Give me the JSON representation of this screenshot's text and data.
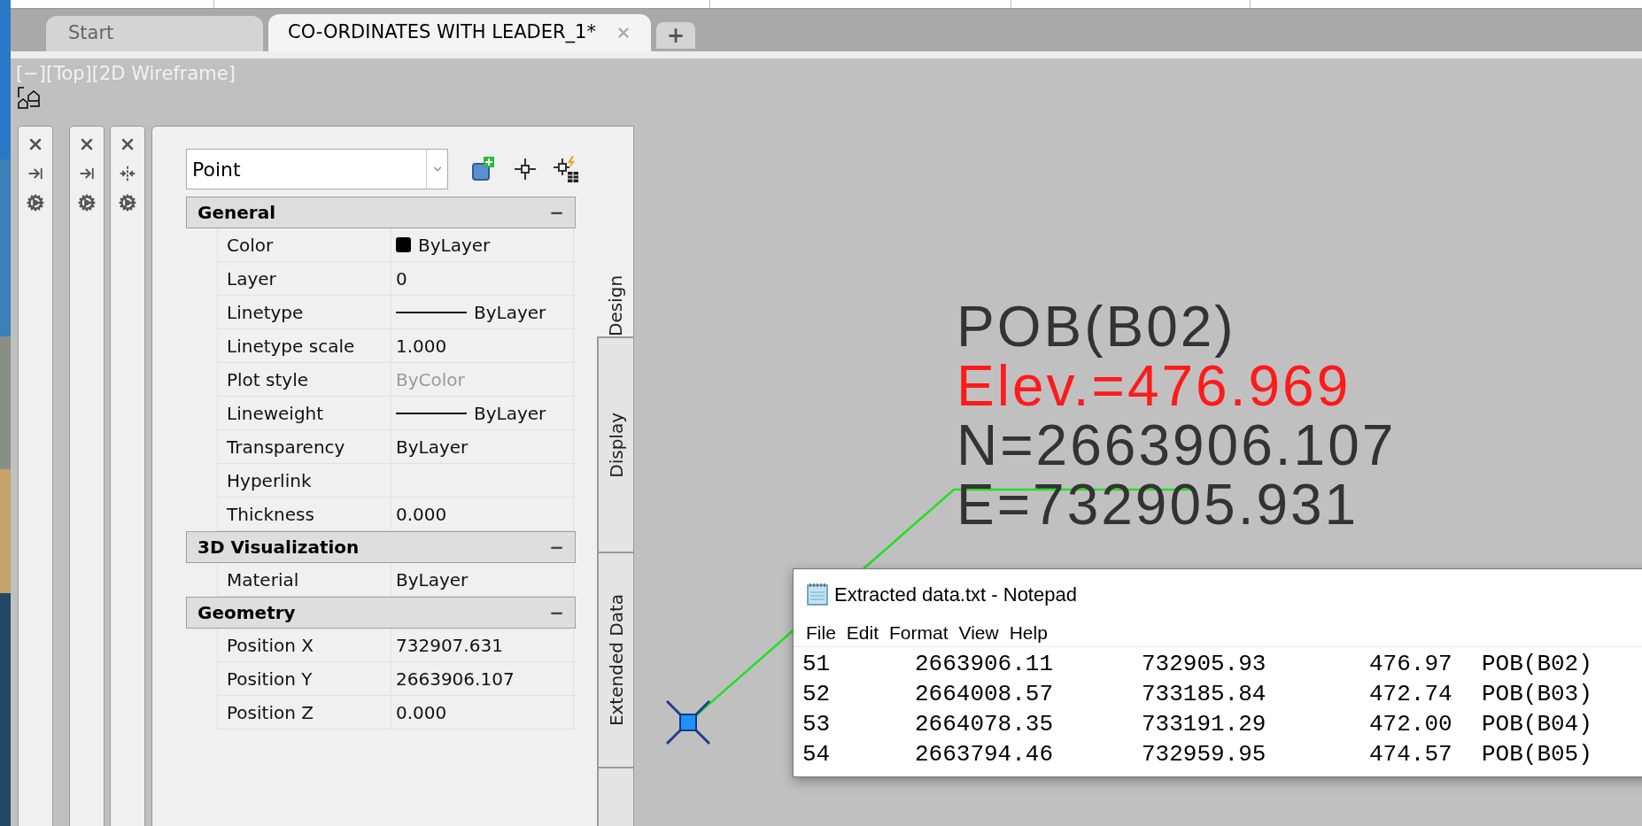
{
  "tabs": [
    {
      "label": "Start",
      "selected": false
    },
    {
      "label": "CO-ORDINATES WITH LEADER_1*",
      "selected": true
    }
  ],
  "new_tab": "+",
  "viewport_label": "[−][Top][2D Wireframe]",
  "properties": {
    "object_type": "Point",
    "sections": [
      {
        "title": "General",
        "toggle": "−",
        "expanded": true,
        "rows": [
          {
            "name": "Color",
            "value": "ByLayer",
            "kind": "swatch"
          },
          {
            "name": "Layer",
            "value": "0",
            "kind": "text"
          },
          {
            "name": "Linetype",
            "value": "ByLayer",
            "kind": "line"
          },
          {
            "name": "Linetype scale",
            "value": "1.000",
            "kind": "text"
          },
          {
            "name": "Plot style",
            "value": "ByColor",
            "kind": "muted"
          },
          {
            "name": "Lineweight",
            "value": "ByLayer",
            "kind": "line"
          },
          {
            "name": "Transparency",
            "value": "ByLayer",
            "kind": "text"
          },
          {
            "name": "Hyperlink",
            "kind": "text"
          },
          {
            "name": "Thickness",
            "value": "0.000",
            "kind": "text"
          }
        ]
      },
      {
        "title": "3D Visualization",
        "toggle": "−",
        "expanded": true,
        "rows": [
          {
            "name": "Material",
            "value": "ByLayer",
            "kind": "text"
          }
        ]
      },
      {
        "title": "Geometry",
        "toggle": "−",
        "expanded": true,
        "rows": [
          {
            "name": "Position X",
            "value": "732907.631",
            "kind": "text"
          },
          {
            "name": "Position Y",
            "value": "2663906.107",
            "kind": "text"
          },
          {
            "name": "Position Z",
            "value": "0.000",
            "kind": "text"
          }
        ]
      }
    ],
    "side_tabs": [
      {
        "label": "Design",
        "selected": true
      },
      {
        "label": "Display",
        "selected": false
      },
      {
        "label": "Extended Data",
        "selected": false
      }
    ]
  },
  "drawing": {
    "label_lines": [
      {
        "text": "POB(B02)",
        "color": "#333333"
      },
      {
        "text": "Elev.=476.969",
        "color": "#ff1a1a"
      },
      {
        "text": "N=2663906.107",
        "color": "#333333"
      },
      {
        "text": "E=732905.931",
        "color": "#333333"
      }
    ]
  },
  "notepad": {
    "title": "Extracted data.txt - Notepad",
    "menu": [
      "File",
      "Edit",
      "Format",
      "View",
      "Help"
    ],
    "rows": [
      [
        "51",
        "2663906.11",
        "732905.93",
        "476.97",
        "POB(B02)"
      ],
      [
        "52",
        "2664008.57",
        "733185.84",
        "472.74",
        "POB(B03)"
      ],
      [
        "53",
        "2664078.35",
        "733191.29",
        "472.00",
        "POB(B04)"
      ],
      [
        "54",
        "2663794.46",
        "732959.95",
        "474.57",
        "POB(B05)"
      ]
    ]
  }
}
